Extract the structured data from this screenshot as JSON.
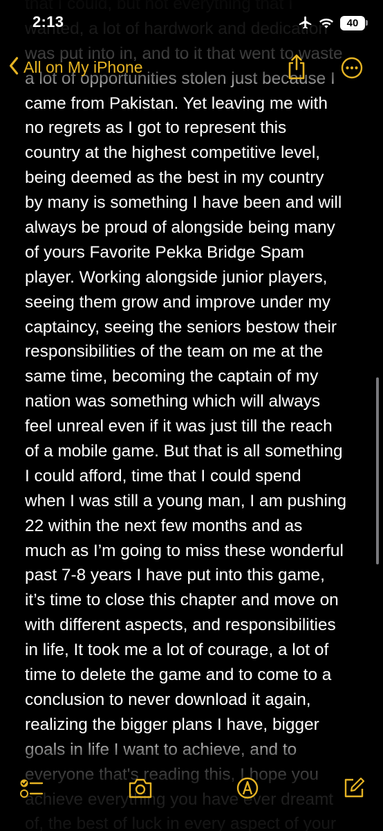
{
  "status_bar": {
    "time": "2:13",
    "battery_level": "40",
    "icons": [
      "airplane-icon",
      "wifi-icon",
      "battery-icon"
    ]
  },
  "nav": {
    "back_label": "All on My iPhone",
    "accent_color": "#e5b324",
    "icons": [
      "chevron-left-icon",
      "share-icon",
      "more-icon"
    ]
  },
  "note": {
    "lines": [
      "that I could, but not everything that I",
      "wanted, a lot of hardwork and dedication",
      "was put into in, and to it that went to waste",
      "a lot of opportunities stolen just because I",
      "came from Pakistan. Yet leaving me with",
      "no regrets as I got to represent this",
      "country at the highest competitive level,",
      "being deemed as the best in my country",
      "by many is something I have been and will",
      "always be proud of alongside being many",
      "of yours Favorite Pekka Bridge Spam",
      "player. Working alongside junior players,",
      "seeing them grow and improve under my",
      "captaincy, seeing the seniors bestow their",
      "responsibilities of the team on me at the",
      "same time, becoming the captain of my",
      "nation was something which will always",
      "feel unreal even if it was just till the reach",
      "of a mobile game. But that is all something",
      "I could afford, time that I could spend",
      "when I was still a young man, I am pushing",
      "22 within the next few months and as",
      "much as I’m going to miss these wonderful",
      "past 7-8 years I have put into this game,",
      "it’s time to close this chapter and move on",
      "with different aspects, and responsibilities",
      "in life, It took me a lot of courage, a lot of",
      "time to delete the game and to come to a",
      "conclusion to never download it again,",
      "realizing the bigger plans I have, bigger",
      "goals in life I want to achieve, and to",
      "everyone that's reading this, I hope you",
      "achieve everything you have ever dreamt",
      "of, the best of luck in every aspect of your"
    ]
  },
  "toolbar": {
    "icons": [
      "checklist-icon",
      "camera-icon",
      "markup-icon",
      "compose-icon"
    ]
  }
}
